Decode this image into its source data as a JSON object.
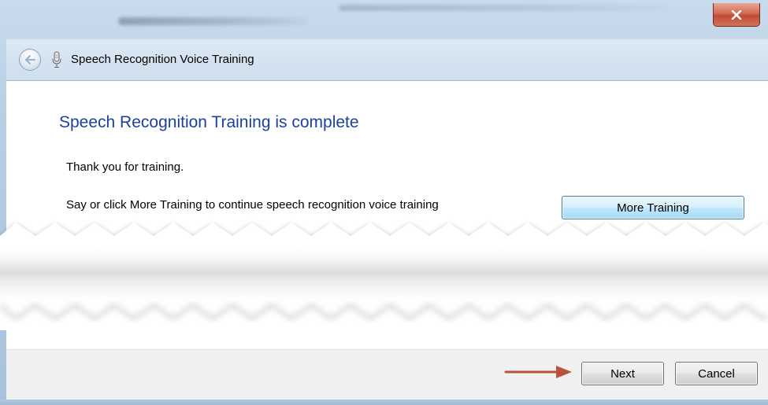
{
  "window": {
    "title": "Speech Recognition Voice Training",
    "close_icon": "close-x-icon",
    "back_icon": "back-arrow-icon",
    "app_icon": "microphone-icon"
  },
  "content": {
    "headline": "Speech Recognition Training is complete",
    "thanks_text": "Thank you for training.",
    "instruction_text": "Say or click More Training to continue speech recognition voice training",
    "more_training_label": "More Training"
  },
  "footer": {
    "next_label": "Next",
    "cancel_label": "Cancel",
    "pointer_icon": "red-arrow-icon"
  },
  "colors": {
    "headline": "#1c3fa0",
    "close_button": "#c14a33",
    "arrow": "#b8523a",
    "button_highlight": "#bee6fd"
  }
}
